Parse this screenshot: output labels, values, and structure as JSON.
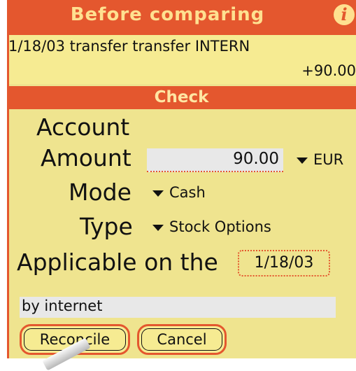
{
  "header": {
    "title": "Before comparing",
    "info_icon": "info-icon"
  },
  "transaction": {
    "description": "1/18/03 transfer transfer INTERN",
    "amount": "+90.00"
  },
  "section": {
    "label": "Check"
  },
  "form": {
    "account_label": "Account",
    "amount_label": "Amount",
    "amount_value": "90.00",
    "currency": "EUR",
    "mode_label": "Mode",
    "mode_value": "Cash",
    "type_label": "Type",
    "type_value": "Stock Options",
    "date_label": "Applicable on the",
    "date_value": "1/18/03",
    "note_value": "by internet"
  },
  "buttons": {
    "reconcile": "Reconcile",
    "cancel": "Cancel"
  },
  "colors": {
    "accent": "#e4572e",
    "background": "#efe48f",
    "field": "#e8e8e8"
  }
}
